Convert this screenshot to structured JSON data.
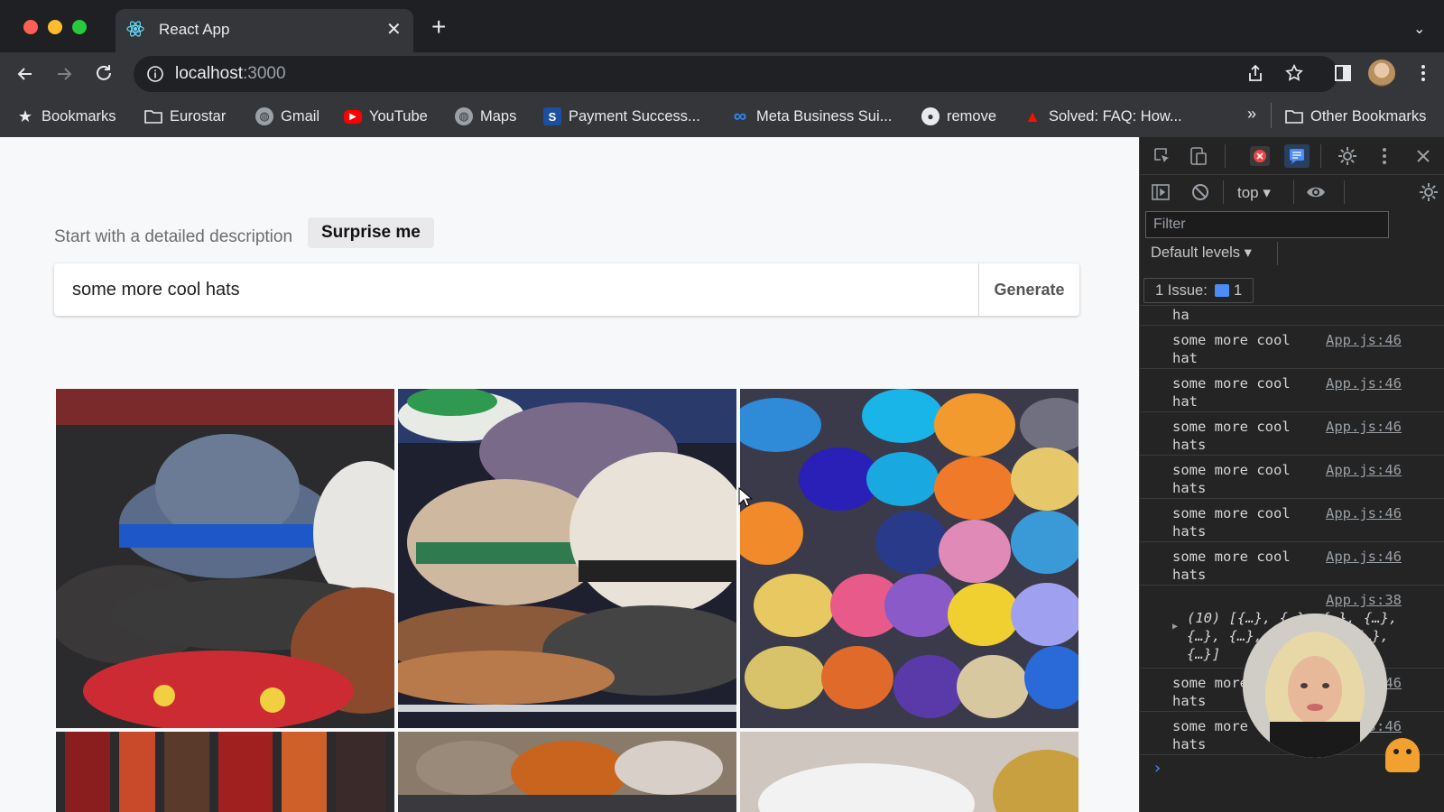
{
  "browser": {
    "tab_title": "React App",
    "tab_close_glyph": "✕",
    "new_tab_glyph": "+",
    "tab_list_glyph": "⌄",
    "url_host": "localhost",
    "url_port": ":3000",
    "icons": [
      "back-icon",
      "forward-icon",
      "reload-icon",
      "info-icon",
      "share-icon",
      "star-icon",
      "side-panel-icon",
      "profile-avatar",
      "menu-icon"
    ]
  },
  "bookmarks": {
    "items": [
      {
        "label": "Bookmarks",
        "icon": "star-icon"
      },
      {
        "label": "Eurostar",
        "icon": "folder-icon"
      },
      {
        "label": "Gmail",
        "icon": "globe-icon"
      },
      {
        "label": "YouTube",
        "icon": "youtube-icon"
      },
      {
        "label": "Maps",
        "icon": "globe-icon"
      },
      {
        "label": "Payment Success...",
        "icon": "stripe-icon"
      },
      {
        "label": "Meta Business Sui...",
        "icon": "meta-icon"
      },
      {
        "label": "remove",
        "icon": "github-icon"
      },
      {
        "label": "Solved: FAQ: How...",
        "icon": "adobe-icon"
      }
    ],
    "overflow": "»",
    "other": "Other Bookmarks"
  },
  "app": {
    "hint": "Start with a detailed description",
    "surprise_label": "Surprise me",
    "prompt_value": "some more cool hats",
    "generate_label": "Generate",
    "images": [
      {
        "name": "generated-image-1",
        "palette": [
          "#2b2b2e",
          "#5b6b8a",
          "#1d57c8",
          "#cc2b33",
          "#8a4a2b"
        ]
      },
      {
        "name": "generated-image-2",
        "palette": [
          "#cfc2b0",
          "#7a6a8a",
          "#2f7a4f",
          "#e8e2d8",
          "#8a5a3a"
        ]
      },
      {
        "name": "generated-image-3",
        "palette": [
          "#f29a2e",
          "#2f8ad8",
          "#d9c36a",
          "#8a5ac8",
          "#e85a8a"
        ]
      },
      {
        "name": "generated-image-4",
        "palette": [
          "#8a1d1d",
          "#c84a2b",
          "#2b2b2e"
        ]
      },
      {
        "name": "generated-image-5",
        "palette": [
          "#9a8a7a",
          "#c8641e",
          "#d8d0c8"
        ]
      },
      {
        "name": "generated-image-6",
        "palette": [
          "#cfc6bf",
          "#f2f2f2",
          "#c8a040"
        ]
      }
    ]
  },
  "devtools": {
    "context": "top ▾",
    "filter_placeholder": "Filter",
    "levels": "Default levels ▾",
    "issues": "1 Issue:",
    "issue_count": "1",
    "logs": [
      {
        "msg": "ha",
        "src": ""
      },
      {
        "msg": "some more cool hat",
        "src": "App.js:46"
      },
      {
        "msg": "some more cool hat",
        "src": "App.js:46"
      },
      {
        "msg": "some more cool hats",
        "src": "App.js:46"
      },
      {
        "msg": "some more cool hats",
        "src": "App.js:46"
      },
      {
        "msg": "some more cool hats",
        "src": "App.js:46"
      },
      {
        "msg": "some more cool hats",
        "src": "App.js:46"
      },
      {
        "msg": "(10) [{…}, {…}, {…}, {…}, {…}, {…}, {…}, {…}, {…}, {…}]",
        "src": "App.js:38"
      },
      {
        "msg": "some more cool hats",
        "src": "App.js:46"
      },
      {
        "msg": "some more cool hats",
        "src": "App.js:46"
      }
    ],
    "prompt_glyph": "›"
  }
}
